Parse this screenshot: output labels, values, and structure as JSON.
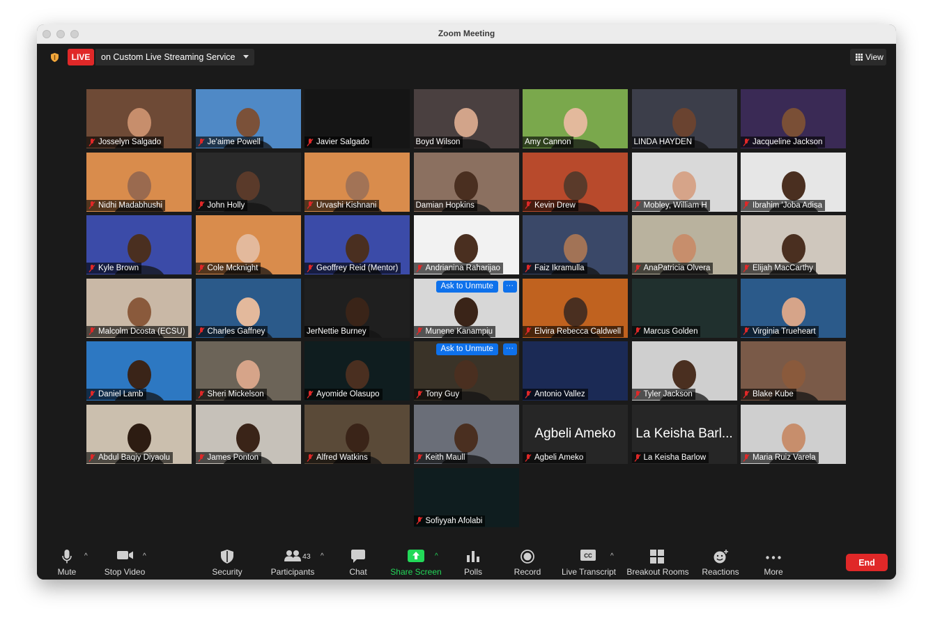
{
  "window": {
    "title": "Zoom Meeting"
  },
  "topbar": {
    "live_label": "LIVE",
    "live_service": "on Custom Live Streaming Service",
    "view_label": "View"
  },
  "participants": [
    {
      "name": "Josselyn Salgado",
      "muted": true,
      "bg": "#6e4a36",
      "skin": "#c78e6c"
    },
    {
      "name": "Je'aime Powell",
      "muted": true,
      "bg": "#4f89c6",
      "skin": "#7b5139"
    },
    {
      "name": "Javier Salgado",
      "muted": true,
      "bg": "#151515",
      "skin": ""
    },
    {
      "name": "Boyd Wilson",
      "muted": false,
      "bg": "#4a4040",
      "skin": "#d2a48a"
    },
    {
      "name": "Amy Cannon",
      "muted": false,
      "bg": "#7aa84c",
      "skin": "#e3b99c"
    },
    {
      "name": "LINDA HAYDEN",
      "muted": false,
      "bg": "#3c3e4a",
      "skin": "#6a4330"
    },
    {
      "name": "Jacqueline Jackson",
      "muted": true,
      "bg": "#3a2a55",
      "skin": "#7a4f36"
    },
    {
      "name": "Nidhi Madabhushi",
      "muted": true,
      "bg": "#d98c4c",
      "skin": "#9a6a4f"
    },
    {
      "name": "John Holly",
      "muted": true,
      "bg": "#2a2a2a",
      "skin": "#5a3a2a"
    },
    {
      "name": "Urvashi Kishnani",
      "muted": true,
      "bg": "#d98c4c",
      "skin": "#a27356"
    },
    {
      "name": "Damian Hopkins",
      "muted": false,
      "bg": "#8b7060",
      "skin": "#4a2f20"
    },
    {
      "name": "Kevin Drew",
      "muted": true,
      "bg": "#b84a2c",
      "skin": "#5a3a2a"
    },
    {
      "name": "Mobley, William H",
      "muted": true,
      "bg": "#d9d9d9",
      "skin": "#d6a489"
    },
    {
      "name": "Ibrahim 'Joba Adisa",
      "muted": true,
      "bg": "#e6e6e6",
      "skin": "#4a2f20"
    },
    {
      "name": "Kyle Brown",
      "muted": true,
      "bg": "#3b4ba8",
      "skin": "#4a2f20"
    },
    {
      "name": "Cole Mcknight",
      "muted": true,
      "bg": "#d98c4c",
      "skin": "#e3b99c"
    },
    {
      "name": "Geoffrey Reid (Mentor)",
      "muted": true,
      "bg": "#3b4ba8",
      "skin": "#4a2f20",
      "active": true
    },
    {
      "name": "Andrianina Raharijao",
      "muted": true,
      "bg": "#f2f2f2",
      "skin": "#4a2f20"
    },
    {
      "name": "Faiz Ikramulla",
      "muted": true,
      "bg": "#3a4868",
      "skin": "#a27356"
    },
    {
      "name": "AnaPatricia Olvera",
      "muted": true,
      "bg": "#b9b29e",
      "skin": "#c78e6c"
    },
    {
      "name": "Elijah MacCarthy",
      "muted": true,
      "bg": "#cfc7bd",
      "skin": "#4a2f20"
    },
    {
      "name": "Malcolm Dcosta (ECSU)",
      "muted": true,
      "bg": "#c9b8a6",
      "skin": "#8a5a3c"
    },
    {
      "name": "Charles Gaffney",
      "muted": true,
      "bg": "#2b5a8a",
      "skin": "#e3b99c"
    },
    {
      "name": "JerNettie Burney",
      "muted": false,
      "bg": "#1f1f1f",
      "skin": "#3a2418"
    },
    {
      "name": "Munene Kanampiu",
      "muted": true,
      "bg": "#d7d7d7",
      "skin": "#3a2418",
      "ask": true
    },
    {
      "name": "Elvira Rebecca Caldwell",
      "muted": true,
      "bg": "#c0621f",
      "skin": "#4a2f20"
    },
    {
      "name": "Marcus Golden",
      "muted": true,
      "bg": "#20302e",
      "skin": ""
    },
    {
      "name": "Virginia Trueheart",
      "muted": true,
      "bg": "#2b5a8a",
      "skin": "#d6a489"
    },
    {
      "name": "Daniel Lamb",
      "muted": true,
      "bg": "#2d78c2",
      "skin": "#3a2418"
    },
    {
      "name": "Sheri Mickelson",
      "muted": true,
      "bg": "#6c6458",
      "skin": "#d6a489"
    },
    {
      "name": "Ayomide Olasupo",
      "muted": true,
      "bg": "#0f1d1f",
      "skin": "#4a2f20"
    },
    {
      "name": "Tony Guy",
      "muted": true,
      "bg": "#3a3328",
      "skin": "#4a2f20",
      "ask": true
    },
    {
      "name": "Antonio Vallez",
      "muted": true,
      "bg": "#1b2a55",
      "skin": ""
    },
    {
      "name": "Tyler Jackson",
      "muted": true,
      "bg": "#cfcfcf",
      "skin": "#4a2f20"
    },
    {
      "name": "Blake Kube",
      "muted": true,
      "bg": "#7a5a48",
      "skin": "#8a5a3c"
    },
    {
      "name": "Abdul Baqiy Diyaolu",
      "muted": true,
      "bg": "#cbbfae",
      "skin": "#2d1c12"
    },
    {
      "name": "James Ponton",
      "muted": true,
      "bg": "#c6c1b9",
      "skin": "#3a2418"
    },
    {
      "name": "Alfred Watkins",
      "muted": true,
      "bg": "#5a4a38",
      "skin": "#3a2418"
    },
    {
      "name": "Keith Maull",
      "muted": true,
      "bg": "#6a6e78",
      "skin": "#4a2f20"
    },
    {
      "name": "Agbeli Ameko",
      "muted": true,
      "bg": "#262626",
      "skin": "",
      "display": "Agbeli Ameko"
    },
    {
      "name": "La Keisha Barlow",
      "muted": true,
      "bg": "#262626",
      "skin": "",
      "display": "La Keisha Barl..."
    },
    {
      "name": "Maria Ruiz Varela",
      "muted": true,
      "bg": "#cfcfcf",
      "skin": "#c78e6c"
    },
    {
      "name": "Sofiyyah Afolabi",
      "muted": true,
      "bg": "#0f1d1f",
      "skin": ""
    }
  ],
  "unmute": {
    "label": "Ask to Unmute",
    "more": "···"
  },
  "toolbar": {
    "mute": "Mute",
    "stop_video": "Stop Video",
    "security": "Security",
    "participants": "Participants",
    "participants_count": "43",
    "chat": "Chat",
    "share_screen": "Share Screen",
    "polls": "Polls",
    "record": "Record",
    "live_transcript": "Live Transcript",
    "breakout_rooms": "Breakout Rooms",
    "reactions": "Reactions",
    "more": "More",
    "end": "End"
  },
  "colors": {
    "live": "#e02828",
    "share_green": "#23d959",
    "unmute_blue": "#0e71eb",
    "active_speaker": "#9be06a",
    "end": "#e02828"
  }
}
